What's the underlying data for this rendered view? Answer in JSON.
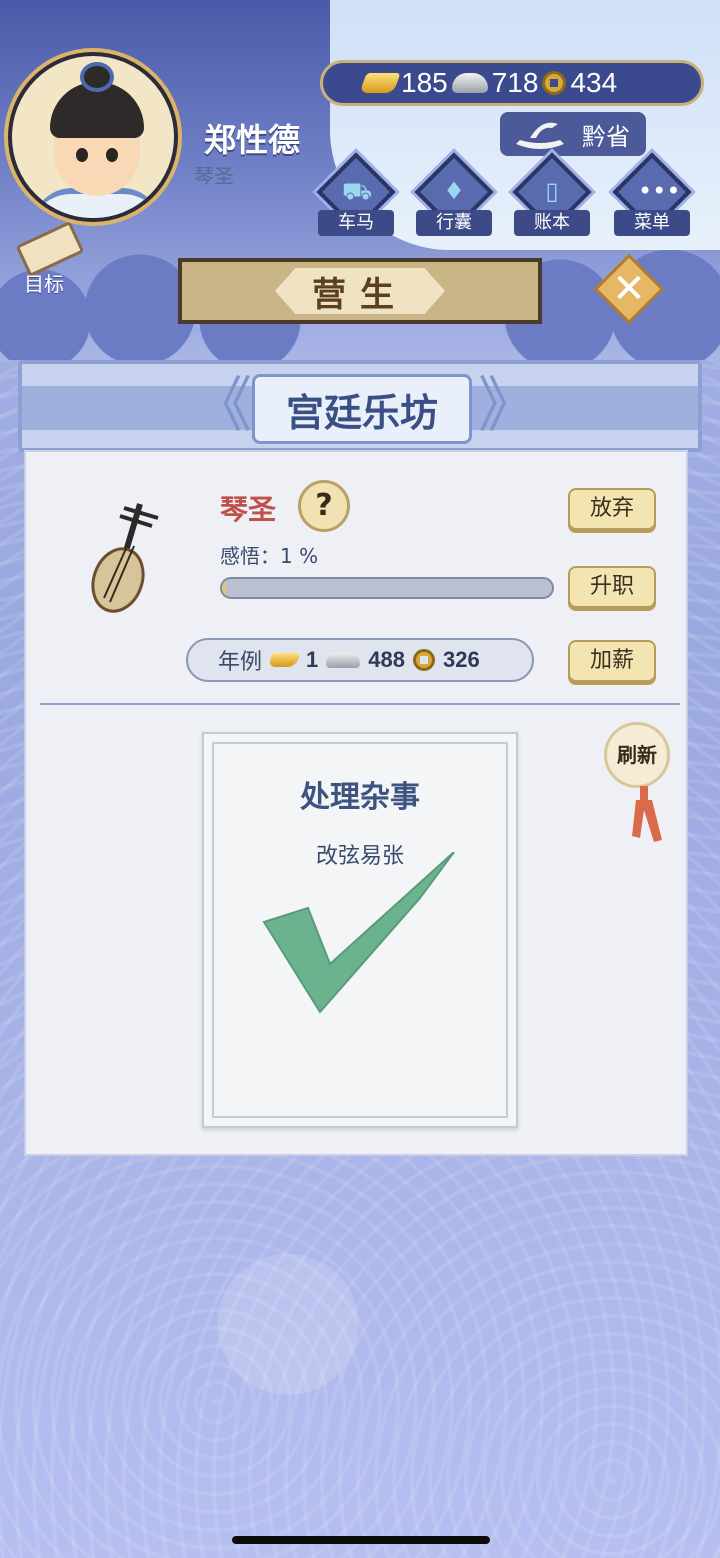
{
  "player": {
    "name": "郑性德",
    "title": "琴圣"
  },
  "currency": {
    "gold": "185",
    "silver": "718",
    "coin": "434"
  },
  "location": {
    "label": "黔省"
  },
  "nav": [
    {
      "label": "车马",
      "icon": "carriage-icon"
    },
    {
      "label": "行囊",
      "icon": "bag-icon"
    },
    {
      "label": "账本",
      "icon": "ledger-icon"
    },
    {
      "label": "菜单",
      "icon": "menu-icon"
    }
  ],
  "goal": {
    "label": "目标"
  },
  "header": {
    "title": "营生"
  },
  "panel": {
    "title": "宫廷乐坊"
  },
  "job": {
    "name": "琴圣",
    "help": "?",
    "insight_label": "感悟：",
    "insight_value": "1 %",
    "progress": 0.01
  },
  "buttons": {
    "abandon": "放弃",
    "promote": "升职",
    "raise": "加薪",
    "refresh": "刷新"
  },
  "salary": {
    "label": "年例",
    "gold": "1",
    "silver": "488",
    "coin": "326"
  },
  "task": {
    "title": "处理杂事",
    "desc": "改弦易张",
    "status_icon": "checkmark-icon"
  },
  "colors": {
    "accent_gold": "#e6b865",
    "job_red": "#c0504a",
    "check_green": "#6bb28f"
  }
}
